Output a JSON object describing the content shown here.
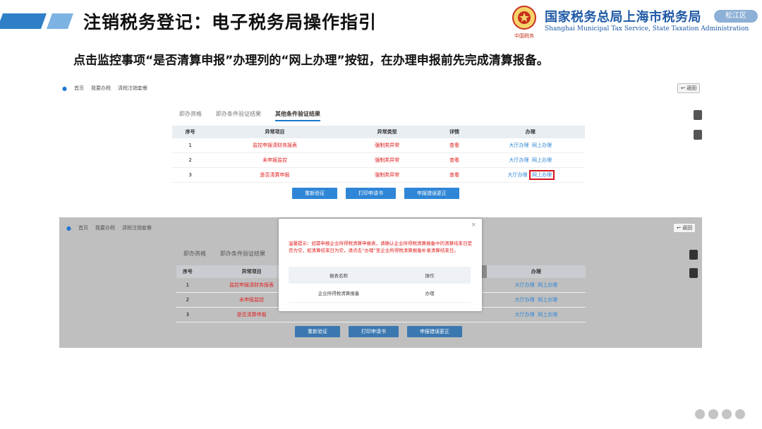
{
  "header": {
    "title": "注销税务登记：电子税务局操作指引",
    "org_cn": "国家税务总局上海市税务局",
    "org_en": "Shanghai Municipal Tax Service, State Taxation Administration",
    "emblem_caption": "中国税务",
    "district_badge": "松江区"
  },
  "instruction": "点击监控事项“是否清算申报”办理列的“网上办理”按钮，在办理申报前先完成清算报备。",
  "panel1": {
    "breadcrumb": [
      "首页",
      "我要办税",
      "清税注销套餐"
    ],
    "back_label": "返回",
    "tabs": [
      "即办资格",
      "即办条件验证结果",
      "其他条件验证结果"
    ],
    "columns": [
      "序号",
      "异常项目",
      "异常类型",
      "详情",
      "办理"
    ],
    "rows": [
      {
        "no": "1",
        "item": "监控申报清财务报表",
        "type": "强制类异常",
        "detail": "查看",
        "hall": "大厅办理",
        "online": "网上办理"
      },
      {
        "no": "2",
        "item": "未申报监控",
        "type": "强制类异常",
        "detail": "查看",
        "hall": "大厅办理",
        "online": "网上办理"
      },
      {
        "no": "3",
        "item": "是否清算申报",
        "type": "强制类异常",
        "detail": "查看",
        "hall": "大厅办理",
        "online": "网上办理"
      }
    ],
    "buttons": [
      "重新验证",
      "打印申请书",
      "申报错误更正"
    ]
  },
  "panel2": {
    "breadcrumb": [
      "首页",
      "我要办税",
      "清税注销套餐"
    ],
    "back_label": "返回",
    "tabs": [
      "即办资格",
      "即办条件验证结果"
    ],
    "columns": [
      "序号",
      "异常项目",
      "办理"
    ],
    "rows": [
      {
        "no": "1",
        "item": "监控申报清财务报表",
        "hall": "大厅办理",
        "online": "网上办理"
      },
      {
        "no": "2",
        "item": "未申报监控",
        "hall": "大厅办理",
        "online": "网上办理"
      },
      {
        "no": "3",
        "item": "是否清算申报",
        "hall": "大厅办理",
        "online": "网上办理"
      }
    ],
    "buttons": [
      "重新验证",
      "打印申请书",
      "申报错误更正"
    ],
    "modal": {
      "warning": "温馨提示：如需申报企业所得税清算申报表，请确认企业所得税清算报备中的清算结束日是否为空，如清算结束日为空，请点击“办理”至企业所得税清算报备补录清算结束日。",
      "columns": [
        "报表名称",
        "操作"
      ],
      "row": {
        "name": "企业所得税清算报备",
        "action": "办理"
      },
      "close": "×"
    }
  },
  "colors": {
    "brand_blue": "#1f5aa6",
    "accent_blue": "#2f86d6",
    "alert_red": "#e02020",
    "highlight_red": "#d6141c"
  }
}
